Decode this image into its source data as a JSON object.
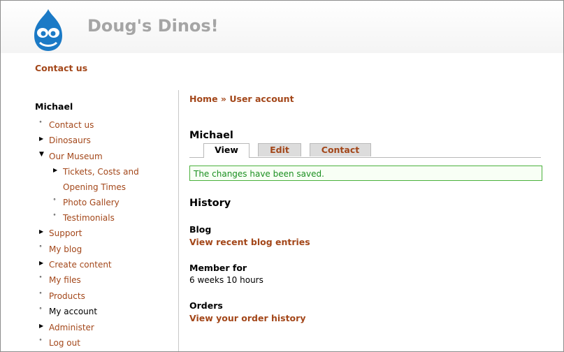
{
  "site": {
    "name": "Doug's Dinos!"
  },
  "primary_link": "Contact us",
  "sidebar": {
    "title": "Michael",
    "items": [
      {
        "label": "Contact us",
        "state": "leaf"
      },
      {
        "label": "Dinosaurs",
        "state": "collapsed"
      },
      {
        "label": "Our Museum",
        "state": "expanded",
        "children": [
          {
            "label": "Tickets, Costs and Opening Times",
            "state": "collapsed"
          },
          {
            "label": "Photo Gallery",
            "state": "leaf"
          },
          {
            "label": "Testimonials",
            "state": "leaf"
          }
        ]
      },
      {
        "label": "Support",
        "state": "collapsed"
      },
      {
        "label": "My blog",
        "state": "leaf"
      },
      {
        "label": "Create content",
        "state": "collapsed"
      },
      {
        "label": "My files",
        "state": "leaf"
      },
      {
        "label": "Products",
        "state": "leaf"
      },
      {
        "label": "My account",
        "state": "leaf",
        "active": true
      },
      {
        "label": "Administer",
        "state": "collapsed"
      },
      {
        "label": "Log out",
        "state": "leaf"
      }
    ]
  },
  "breadcrumb": {
    "home": "Home",
    "separator": "»",
    "current": "User account"
  },
  "page_title": "Michael",
  "tabs": [
    {
      "label": "View",
      "active": true
    },
    {
      "label": "Edit",
      "active": false
    },
    {
      "label": "Contact",
      "active": false
    }
  ],
  "status_message": "The changes have been saved.",
  "history": {
    "title": "History",
    "blog_label": "Blog",
    "blog_link": "View recent blog entries",
    "member_label": "Member for",
    "member_value": "6 weeks 10 hours",
    "orders_label": "Orders",
    "orders_link": "View your order history"
  },
  "colors": {
    "link": "#a3471a",
    "status_border": "#4ab13c",
    "status_text": "#1b8f20",
    "logo": "#1b7ac6"
  }
}
